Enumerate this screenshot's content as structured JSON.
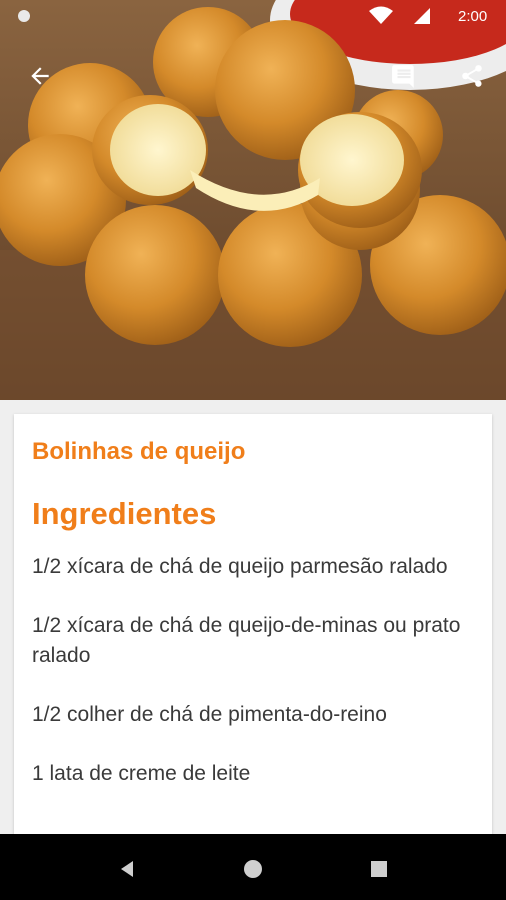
{
  "status_bar": {
    "time": "2:00"
  },
  "toolbar": {
    "back_icon": "arrow-left-icon",
    "comments_icon": "comment-icon",
    "share_icon": "share-icon"
  },
  "recipe": {
    "title": "Bolinhas de queijo",
    "section_title": "Ingredientes",
    "ingredients": [
      "1/2 xícara de chá de queijo parmesão ralado",
      "1/2 xícara de chá de queijo-de-minas ou prato ralado",
      "1/2 colher de chá de pimenta-do-reino",
      "1 lata de creme de leite"
    ]
  },
  "colors": {
    "accent": "#f07e1a",
    "text": "#3a3a3a",
    "background": "#efefef",
    "navbar": "#000000"
  },
  "nav_bar": {
    "back_icon": "triangle-back-icon",
    "home_icon": "circle-home-icon",
    "recents_icon": "square-recents-icon"
  }
}
